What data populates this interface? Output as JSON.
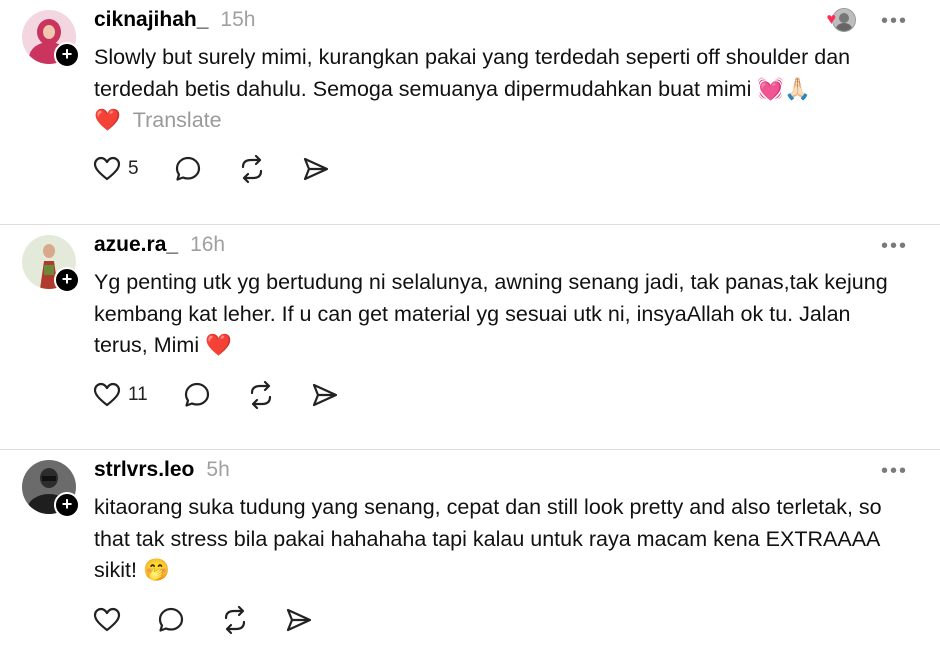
{
  "posts": [
    {
      "username": "ciknajihah_",
      "time": "15h",
      "text": "Slowly but surely mimi, kurangkan pakai yang terdedah seperti off shoulder dan terdedah betis dahulu. Semoga semuanya dipermudahkan buat mimi 💓🙏🏻",
      "text2": "❤️",
      "translate": "Translate",
      "likes": "5",
      "avatar_color": "#c9355e"
    },
    {
      "username": "azue.ra_",
      "time": "16h",
      "text": "Yg penting utk yg bertudung ni selalunya, awning senang jadi, tak panas,tak kejung kembang kat leher. If u can get material yg sesuai utk ni, insyaAllah ok tu. Jalan terus, Mimi ❤️",
      "likes": "11",
      "avatar_color": "#8a4b3a"
    },
    {
      "username": "strlvrs.leo",
      "time": "5h",
      "text": "kitaorang suka tudung yang senang, cepat dan still look pretty and also terletak, so that tak stress bila pakai hahahaha tapi kalau untuk raya macam kena EXTRAAAA sikit! 🤭",
      "avatar_color": "#3a3a3a"
    }
  ],
  "icons": {
    "more": "more-icon",
    "like": "heart-icon",
    "comment": "comment-icon",
    "repost": "repost-icon",
    "share": "share-icon"
  }
}
